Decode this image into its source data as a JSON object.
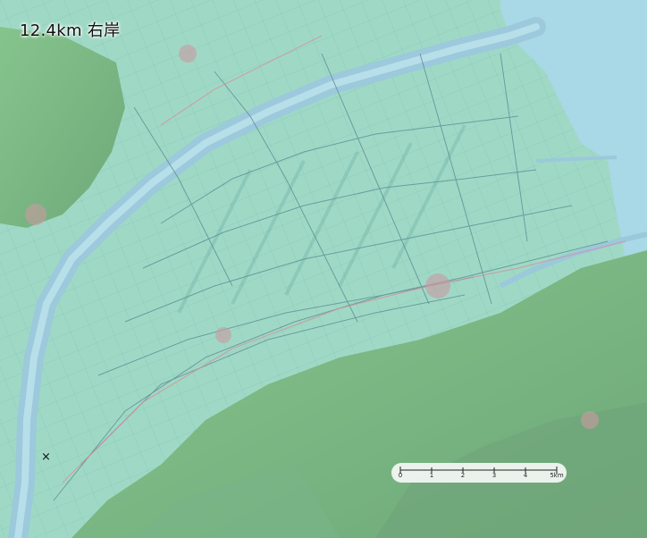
{
  "title": "12.4km 右岸",
  "marker_symbol": "×",
  "scale_bar": {
    "labels": [
      "0",
      "1",
      "2",
      "3",
      "4",
      "5km"
    ],
    "unit": "km"
  },
  "colors": {
    "plain": "#9fd9c6",
    "water": "#a9d8e6",
    "river": "#9cc8dc",
    "hills": "#7fb98f",
    "roads": "#5f8d93"
  }
}
